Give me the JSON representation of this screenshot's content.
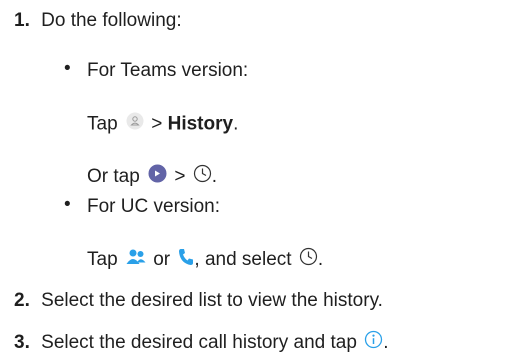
{
  "steps": [
    {
      "number": "1.",
      "text": "Do the following:"
    },
    {
      "number": "2.",
      "text": "Select the desired list to view the history."
    },
    {
      "number": "3.",
      "text": "Select the desired call history and tap"
    }
  ],
  "teams": {
    "bullet": "•",
    "heading": "For Teams version:",
    "tap_prefix": "Tap",
    "separator": ">",
    "history_label": "History",
    "period": ".",
    "or_tap_prefix": "Or tap",
    "separator2": ">",
    "period2": "."
  },
  "uc": {
    "bullet": "•",
    "heading": "For UC version:",
    "tap_prefix": "Tap",
    "or_text": "or",
    "and_select": ", and select",
    "period": "."
  },
  "step3_period": ".",
  "icons": {
    "profile": "profile-icon",
    "presence": "presence-icon",
    "clock": "clock-icon",
    "contacts": "contacts-icon",
    "phone": "phone-icon",
    "info": "info-icon"
  },
  "colors": {
    "text": "#1f1f1f",
    "icon_blue": "#2aa0e8",
    "icon_purple": "#6264a7",
    "icon_grey": "#9a9a9a"
  }
}
